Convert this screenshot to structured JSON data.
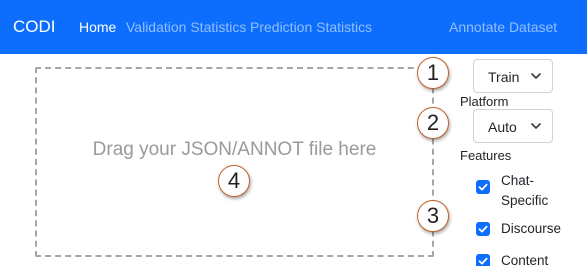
{
  "navbar": {
    "brand": "CODI",
    "links": [
      "Home",
      "Validation Statistics",
      "Prediction Statistics"
    ],
    "right_link": "Annotate Dataset",
    "color": "#0d6efd"
  },
  "dropzone": {
    "text": "Drag your JSON/ANNOT file here"
  },
  "markers": [
    "1",
    "2",
    "3",
    "4"
  ],
  "split_select": {
    "value": "Train",
    "icon": "chevron-down-icon"
  },
  "platform": {
    "label": "Platform",
    "value": "Auto",
    "icon": "chevron-down-icon"
  },
  "features": {
    "label": "Features",
    "items": [
      {
        "label": "Chat-Specific",
        "checked": true
      },
      {
        "label": "Discourse",
        "checked": true
      },
      {
        "label": "Content",
        "checked": true
      }
    ]
  }
}
